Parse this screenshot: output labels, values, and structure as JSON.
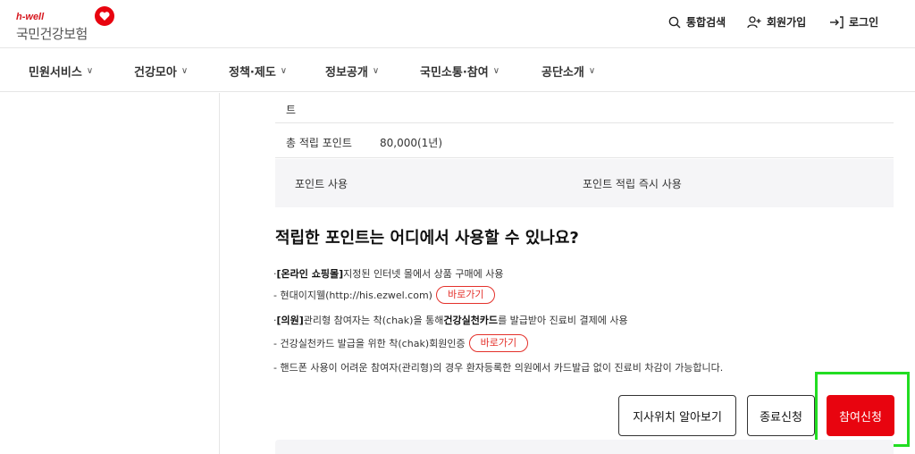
{
  "header": {
    "logo_sub": "h-well",
    "logo_main": "국민건강보험",
    "util": {
      "search": "통합검색",
      "join": "회원가입",
      "login": "로그인"
    }
  },
  "gnb": {
    "items": [
      {
        "label": "민원서비스"
      },
      {
        "label": "건강모아"
      },
      {
        "label": "정책·제도"
      },
      {
        "label": "정보공개"
      },
      {
        "label": "국민소통·참여"
      },
      {
        "label": "공단소개"
      }
    ],
    "chevron": "∨"
  },
  "table": {
    "row1_tail": "트",
    "total_label": "총 적립 포인트",
    "total_value": "80,000(1년)",
    "use_label": "포인트 사용",
    "use_value": "포인트 적립 즉시 사용"
  },
  "section": {
    "title": "적립한 포인트는 어디에서 사용할 수 있나요?",
    "lines": {
      "l1_prefix": "· ",
      "l1_bold": "[온라인 쇼핑몰]",
      "l1_rest": " 지정된 인터넷 몰에서 상품 구매에 사용",
      "l2_text": "- 현대이지웰(http://his.ezwel.com)",
      "l2_link": "바로가기",
      "l3_prefix": "· ",
      "l3_bold1": "[의원]",
      "l3_mid": " 관리형 참여자는 착(chak)을 통해 ",
      "l3_bold2": "건강실천카드",
      "l3_rest": "를 발급받아 진료비 결제에 사용",
      "l4_text": "- 건강실천카드 발급을 위한 착(chak)회원인증",
      "l4_link": "바로가기",
      "l5_text": "- 핸드폰 사용이 어려운 참여자(관리형)의 경우 환자등록한 의원에서 카드발급 없이 진료비 차감이 가능합니다."
    }
  },
  "buttons": {
    "branch": "지사위치 알아보기",
    "end": "종료신청",
    "join": "참여신청"
  },
  "colors": {
    "brand_red": "#e8040f",
    "link_red": "#e4312b",
    "highlight_green": "#22dd22"
  }
}
